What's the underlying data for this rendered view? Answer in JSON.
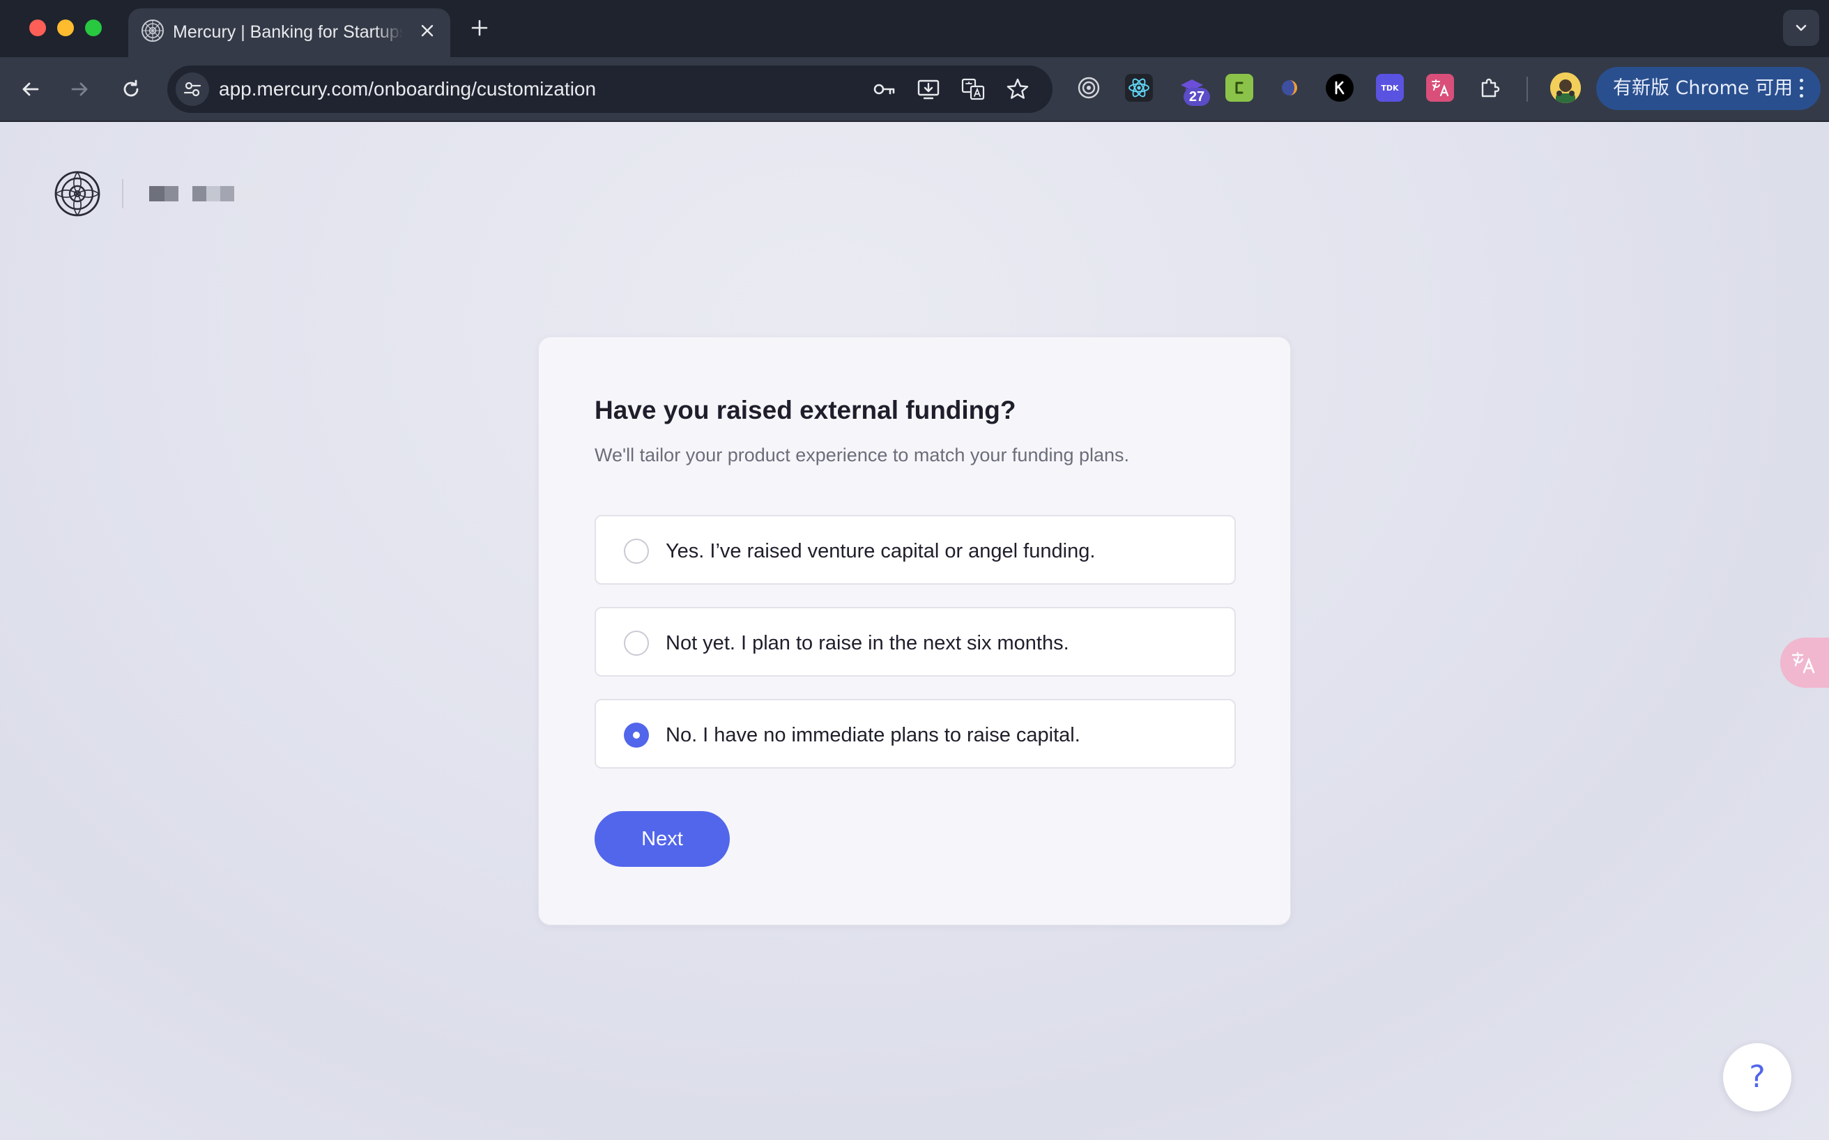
{
  "browser": {
    "tab_title": "Mercury | Banking for Startups",
    "url": "app.mercury.com/onboarding/customization",
    "extension_badge": "27",
    "update_button_label": "有新版 Chrome 可用",
    "icons": {
      "tab_favicon": "mercury-logo-icon",
      "close": "close-icon",
      "new_tab": "plus-icon",
      "tab_search": "chevron-down-icon",
      "back": "back-arrow-icon",
      "forward": "forward-arrow-icon",
      "reload": "reload-icon",
      "site_info": "site-settings-icon",
      "password": "key-icon",
      "install": "install-app-icon",
      "translate": "translate-icon",
      "bookmark": "star-icon",
      "extensions": "puzzle-icon",
      "menu": "kebab-menu-icon"
    },
    "colors": {
      "chrome_dark": "#1e232e",
      "chrome_toolbar": "#343a47",
      "update_pill": "#2a4f8e"
    }
  },
  "page": {
    "question": "Have you raised external funding?",
    "subtitle": "We'll tailor your product experience to match your funding plans.",
    "options": [
      {
        "label": "Yes. I’ve raised venture capital or angel funding.",
        "selected": false
      },
      {
        "label": "Not yet. I plan to raise in the next six months.",
        "selected": false
      },
      {
        "label": "No. I have no immediate plans to raise capital.",
        "selected": true
      }
    ],
    "next_label": "Next",
    "help_label": "?",
    "colors": {
      "accent": "#5266eb",
      "card_bg": "#f6f6fa",
      "text_primary": "#1e1f2b",
      "text_secondary": "#6b6d7a"
    }
  }
}
